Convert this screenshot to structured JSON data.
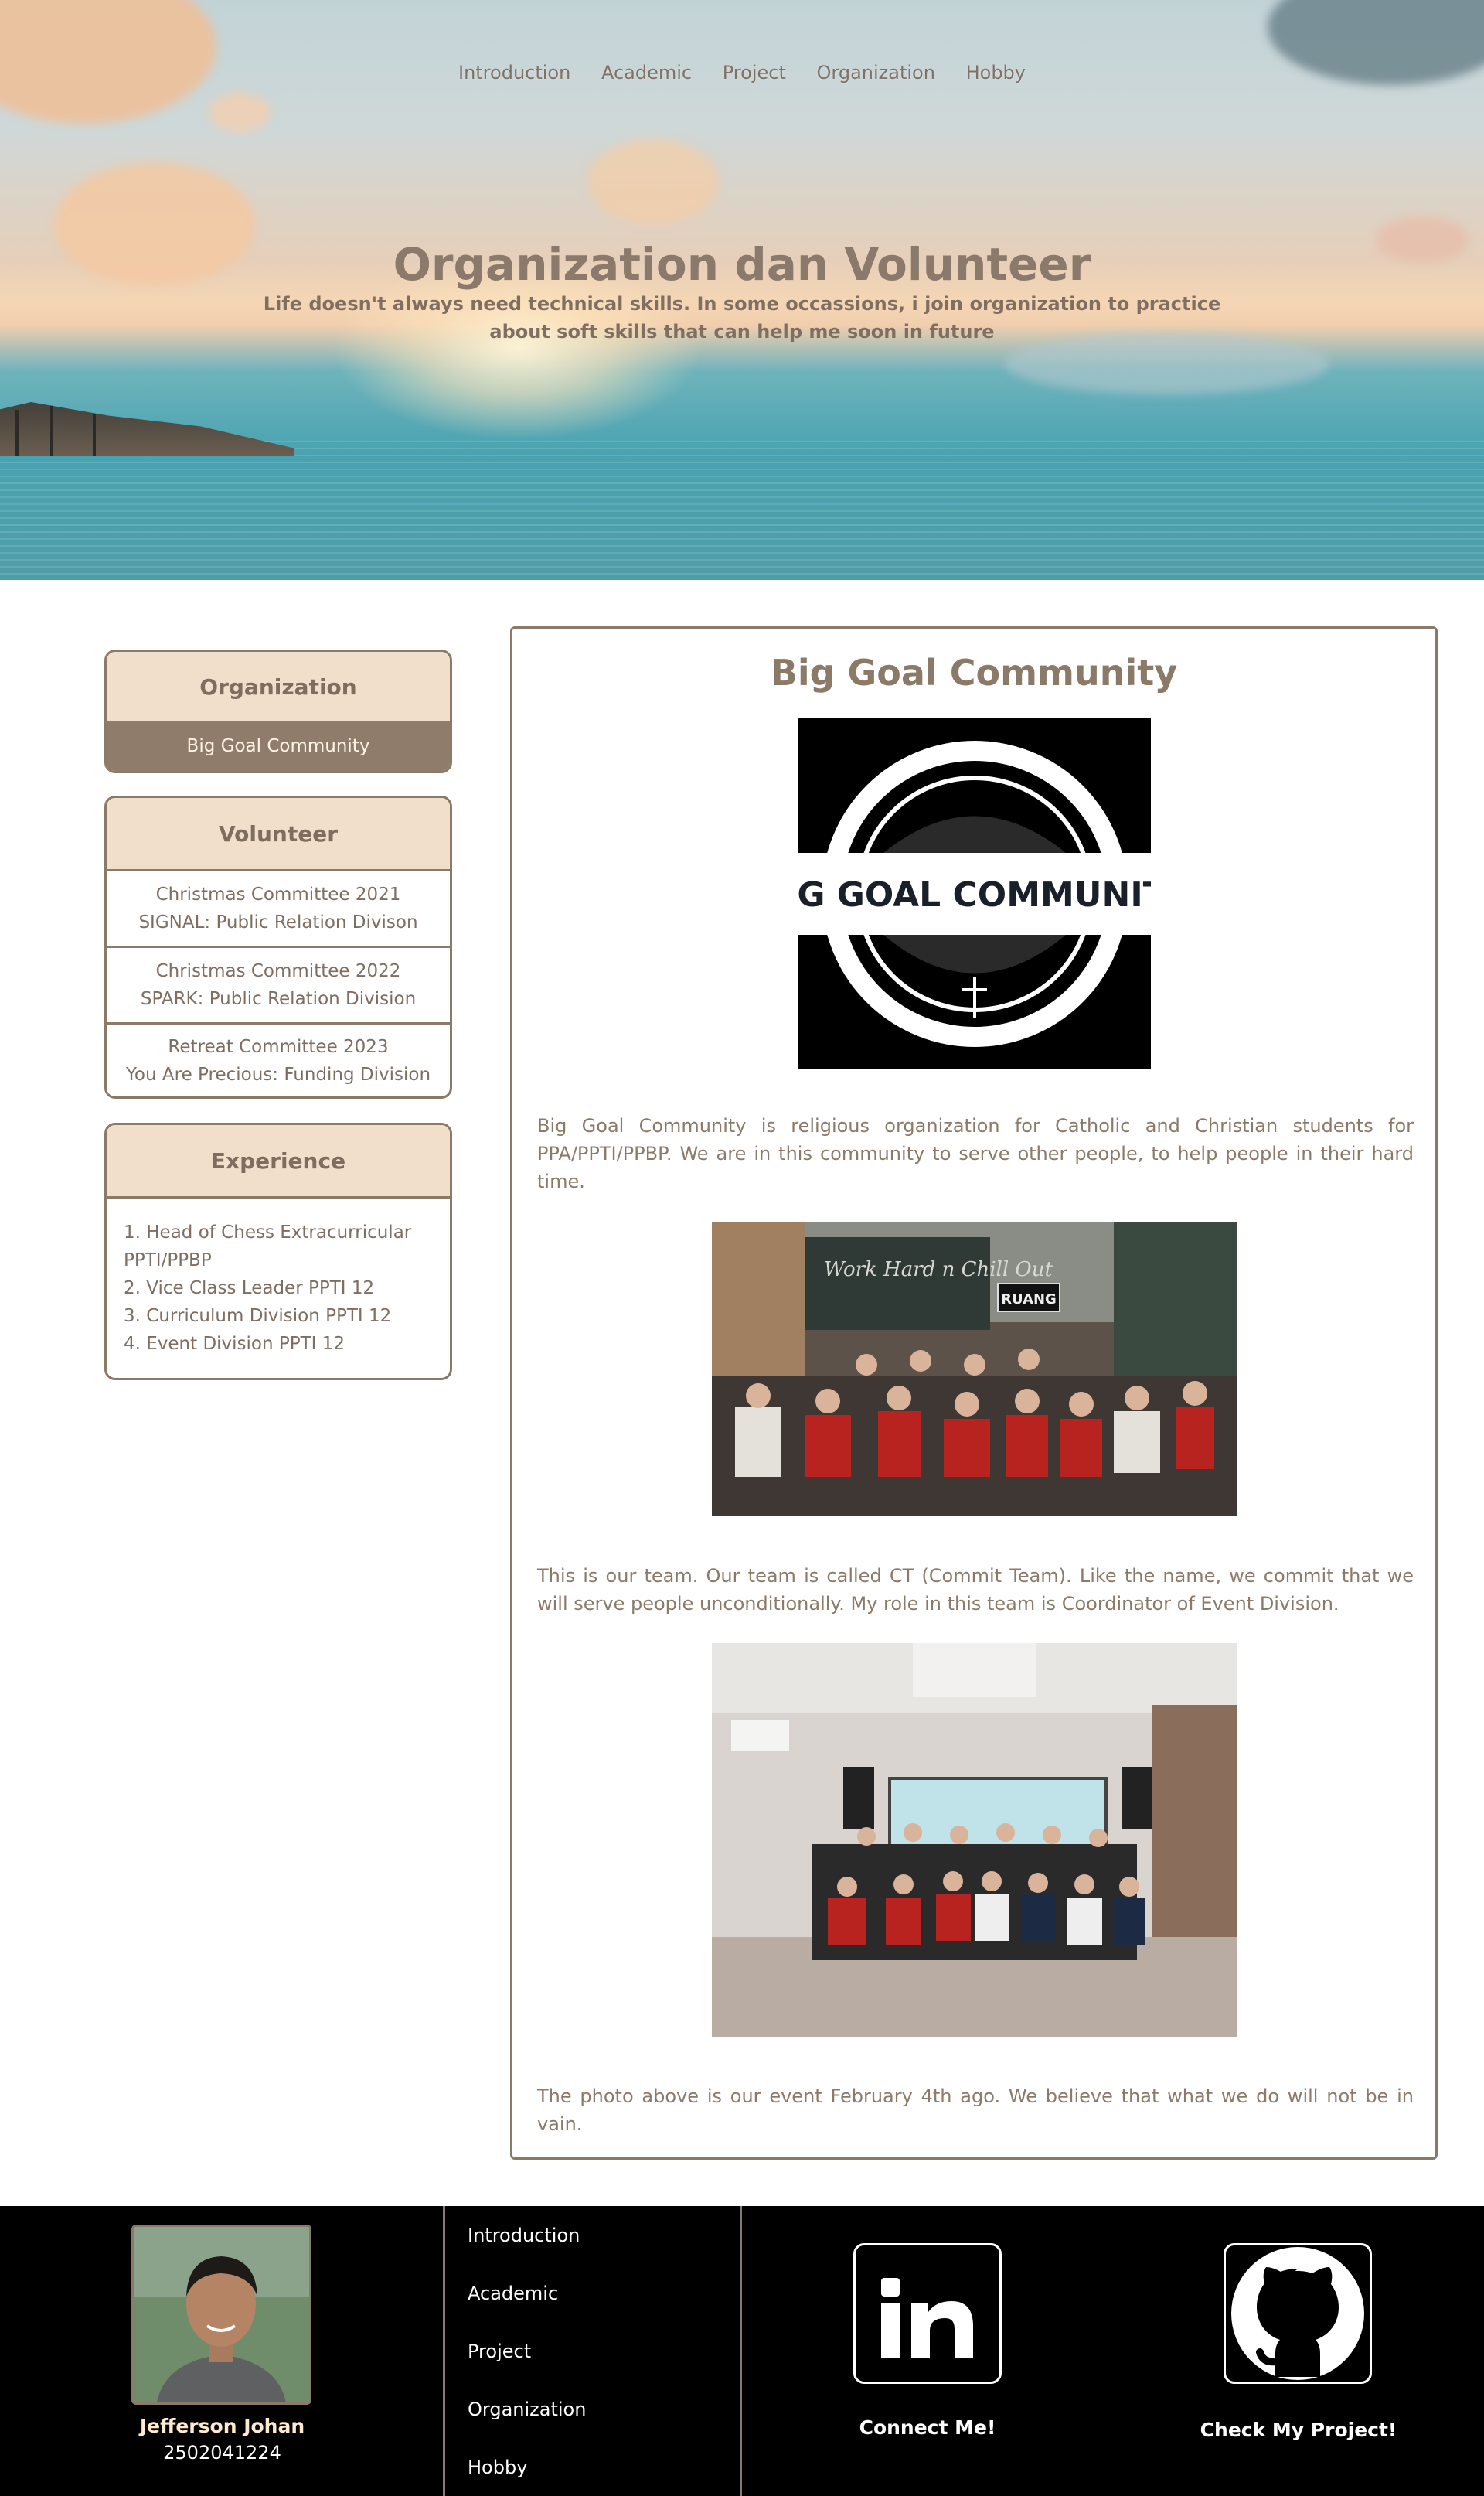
{
  "nav": {
    "items": [
      "Introduction",
      "Academic",
      "Project",
      "Organization",
      "Hobby"
    ]
  },
  "hero": {
    "title": "Organization dan Volunteer",
    "subtitle": "Life doesn't always need technical skills. In some occassions, i join organization to practice about soft skills that can help me soon in future"
  },
  "sidebar": {
    "organization": {
      "heading": "Organization",
      "items": [
        "Big Goal Community"
      ]
    },
    "volunteer": {
      "heading": "Volunteer",
      "items": [
        {
          "line1": "Christmas Committee 2021",
          "line2": "SIGNAL: Public Relation Divison"
        },
        {
          "line1": "Christmas Committee 2022",
          "line2": "SPARK: Public Relation Division"
        },
        {
          "line1": "Retreat Committee 2023",
          "line2": "You Are Precious: Funding Division"
        }
      ]
    },
    "experience": {
      "heading": "Experience",
      "items": [
        "1. Head of Chess Extracurricular PPTI/PPBP",
        "2. Vice Class Leader PPTI 12",
        "3. Curriculum Division PPTI 12",
        "4. Event Division PPTI 12"
      ]
    }
  },
  "article": {
    "title": "Big Goal Community",
    "logo_text": "BIG GOAL COMMUNITY",
    "photo1_banner": "RUANG",
    "photo1_sign": "Work Hard n Chill Out",
    "paragraphs": [
      "Big Goal Community is religious organization for Catholic and Christian students for PPA/PPTI/PPBP. We are in this community to serve other people, to help people in their hard time.",
      "This is our team. Our team is called CT (Commit Team). Like the name, we commit that we will serve people unconditionally. My role in this team is Coordinator of Event Division.",
      "The photo above is our event February 4th ago. We believe that what we do will not be in vain."
    ]
  },
  "footer": {
    "name": "Jefferson Johan",
    "student_id": "2502041224",
    "nav": [
      "Introduction",
      "Academic",
      "Project",
      "Organization",
      "Hobby"
    ],
    "linkedin_label": "Connect Me!",
    "github_label": "Check My Project!"
  },
  "colors": {
    "accent": "#8c7a68",
    "card_header": "#f1dfcc",
    "active_item": "#8f7c6a",
    "footer_bg": "#000000",
    "footer_name": "#ffe9cf"
  }
}
